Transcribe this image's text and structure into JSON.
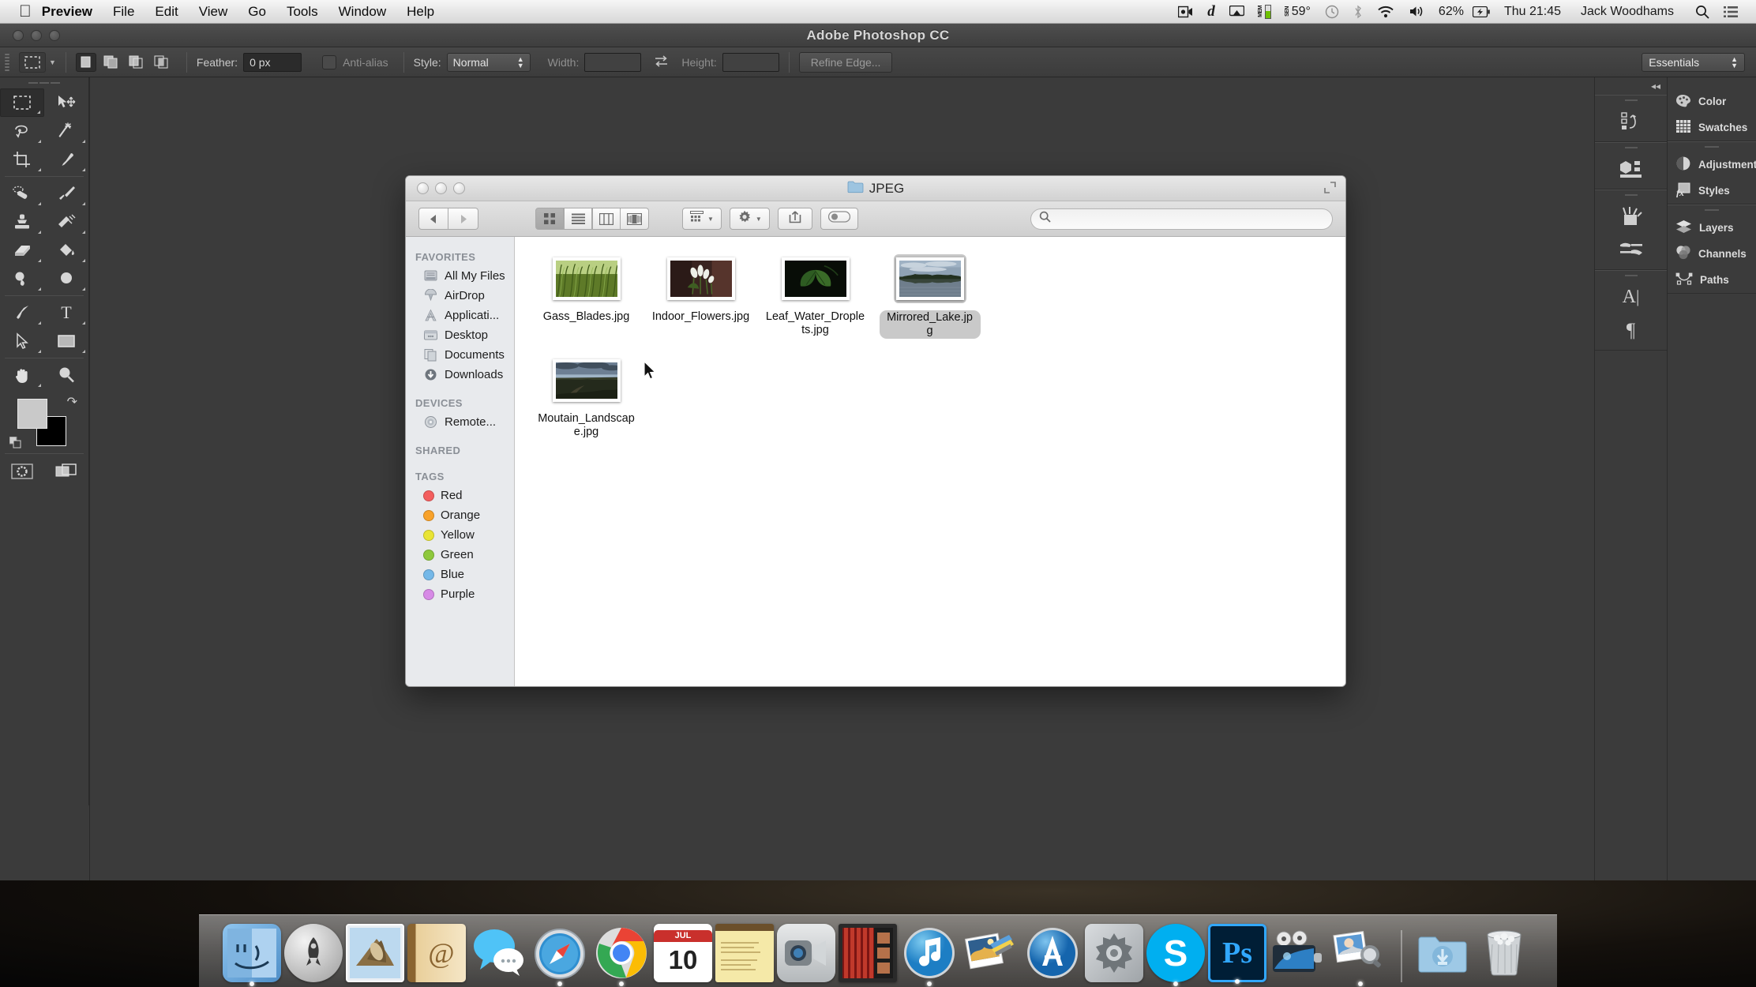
{
  "menubar": {
    "apple_icon": "apple-icon",
    "items": [
      {
        "label": "Preview",
        "bold": true
      },
      {
        "label": "File",
        "bold": false
      },
      {
        "label": "Edit",
        "bold": false
      },
      {
        "label": "View",
        "bold": false
      },
      {
        "label": "Go",
        "bold": false
      },
      {
        "label": "Tools",
        "bold": false
      },
      {
        "label": "Window",
        "bold": false
      },
      {
        "label": "Help",
        "bold": false
      }
    ],
    "status": {
      "screencast_icon": "screen-record-icon",
      "dropbox_icon": "dropbox-d-icon",
      "airplay_icon": "airplay-icon",
      "mem_label": "MEM",
      "sen_label": "SEN",
      "temperature": "59°",
      "timemachine_icon": "time-machine-icon",
      "bluetooth_icon": "bluetooth-icon",
      "wifi_icon": "wifi-icon",
      "volume_icon": "volume-icon",
      "battery_percent": "62%",
      "battery_icon": "battery-charging-icon",
      "clock": "Thu 21:45",
      "user": "Jack Woodhams",
      "spotlight_icon": "search-icon",
      "notification_icon": "notification-center-icon"
    }
  },
  "photoshop": {
    "title": "Adobe Photoshop CC",
    "options": {
      "tool_icon": "rectangular-marquee-icon",
      "selection_modes": [
        "new-selection",
        "add-to-selection",
        "subtract-from-selection",
        "intersect-selection"
      ],
      "feather_label": "Feather:",
      "feather_value": "0 px",
      "antialias_label": "Anti-alias",
      "antialias_checked": false,
      "style_label": "Style:",
      "style_value": "Normal",
      "width_label": "Width:",
      "width_value": "",
      "swap_icon": "swap-dimensions-icon",
      "height_label": "Height:",
      "height_value": "",
      "refine_edge_label": "Refine Edge...",
      "workspace_value": "Essentials"
    },
    "tools": [
      {
        "name": "rectangular-marquee-tool",
        "active": true
      },
      {
        "name": "move-tool",
        "active": false
      },
      {
        "name": "lasso-tool",
        "active": false
      },
      {
        "name": "magic-wand-tool",
        "active": false
      },
      {
        "name": "crop-tool",
        "active": false
      },
      {
        "name": "eyedropper-tool",
        "active": false
      },
      {
        "name": "spot-healing-brush-tool",
        "active": false
      },
      {
        "name": "brush-tool",
        "active": false
      },
      {
        "name": "clone-stamp-tool",
        "active": false
      },
      {
        "name": "history-brush-tool",
        "active": false
      },
      {
        "name": "eraser-tool",
        "active": false
      },
      {
        "name": "paint-bucket-tool",
        "active": false
      },
      {
        "name": "dodge-tool",
        "active": false
      },
      {
        "name": "blur-tool",
        "active": false
      },
      {
        "name": "pen-tool",
        "active": false
      },
      {
        "name": "type-tool",
        "active": false
      },
      {
        "name": "path-selection-tool",
        "active": false
      },
      {
        "name": "rectangle-shape-tool",
        "active": false
      },
      {
        "name": "hand-tool",
        "active": false
      },
      {
        "name": "zoom-tool",
        "active": false
      }
    ],
    "color_swatches": {
      "foreground": "#c9c9c9",
      "background": "#000000"
    },
    "bottom_tools": [
      {
        "name": "quick-mask-tool"
      },
      {
        "name": "screen-mode-tool"
      }
    ],
    "rail_icons": [
      {
        "name": "history-panel-icon"
      },
      {
        "name": "3d-panel-icon"
      },
      {
        "name": "brush-panel-icon"
      },
      {
        "name": "brush-presets-panel-icon"
      },
      {
        "name": "character-panel-icon"
      },
      {
        "name": "paragraph-panel-icon"
      }
    ],
    "panel_groups": [
      {
        "items": [
          {
            "label": "Color",
            "icon": "color-palette-icon"
          },
          {
            "label": "Swatches",
            "icon": "swatches-grid-icon"
          }
        ]
      },
      {
        "items": [
          {
            "label": "Adjustments",
            "icon": "adjustments-circle-icon"
          },
          {
            "label": "Styles",
            "icon": "styles-fx-icon"
          }
        ]
      },
      {
        "items": [
          {
            "label": "Layers",
            "icon": "layers-icon"
          },
          {
            "label": "Channels",
            "icon": "channels-icon"
          },
          {
            "label": "Paths",
            "icon": "paths-icon"
          }
        ]
      }
    ],
    "collapse_icon": "collapse-panels-icon"
  },
  "finder": {
    "title": "JPEG",
    "folder_icon": "folder-icon",
    "window_controls": [
      "close-button",
      "minimize-button",
      "zoom-button"
    ],
    "fullscreen_icon": "fullscreen-icon",
    "toolbar": {
      "back_icon": "back-arrow-icon",
      "forward_icon": "forward-arrow-icon",
      "view_modes": [
        {
          "name": "icon-view",
          "active": true
        },
        {
          "name": "list-view",
          "active": false
        },
        {
          "name": "column-view",
          "active": false
        },
        {
          "name": "coverflow-view",
          "active": false
        }
      ],
      "arrange_icon": "arrange-by-icon",
      "action_icon": "gear-icon",
      "share_icon": "share-icon",
      "tags_icon": "tags-icon"
    },
    "search": {
      "icon": "search-icon",
      "placeholder": "",
      "value": ""
    },
    "sidebar": [
      {
        "header": "FAVORITES",
        "items": [
          {
            "label": "All My Files",
            "icon": "all-my-files-icon"
          },
          {
            "label": "AirDrop",
            "icon": "airdrop-icon"
          },
          {
            "label": "Applicati...",
            "icon": "applications-icon"
          },
          {
            "label": "Desktop",
            "icon": "desktop-icon"
          },
          {
            "label": "Documents",
            "icon": "documents-icon"
          },
          {
            "label": "Downloads",
            "icon": "downloads-icon"
          }
        ]
      },
      {
        "header": "DEVICES",
        "items": [
          {
            "label": "Remote...",
            "icon": "remote-disc-icon"
          }
        ]
      },
      {
        "header": "SHARED",
        "items": []
      },
      {
        "header": "TAGS",
        "items": [
          {
            "label": "Red",
            "icon": "tag-dot",
            "color": "#f35e5e"
          },
          {
            "label": "Orange",
            "icon": "tag-dot",
            "color": "#f8a22a"
          },
          {
            "label": "Yellow",
            "icon": "tag-dot",
            "color": "#e9e435"
          },
          {
            "label": "Green",
            "icon": "tag-dot",
            "color": "#8ec83c"
          },
          {
            "label": "Blue",
            "icon": "tag-dot",
            "color": "#74b8e8"
          },
          {
            "label": "Purple",
            "icon": "tag-dot",
            "color": "#d78ae6"
          }
        ]
      }
    ],
    "files": [
      {
        "name": "Gass_Blades.jpg",
        "selected": false,
        "thumb": "grass"
      },
      {
        "name": "Indoor_Flowers.jpg",
        "selected": false,
        "thumb": "flowers"
      },
      {
        "name": "Leaf_Water_Droplets.jpg",
        "selected": false,
        "thumb": "leaf"
      },
      {
        "name": "Mirrored_Lake.jpg",
        "selected": true,
        "thumb": "lake"
      },
      {
        "name": "Moutain_Landscape.jpg",
        "selected": false,
        "thumb": "mountain"
      }
    ],
    "cursor": "arrow-cursor"
  },
  "dock": {
    "items": [
      {
        "label": "Finder",
        "icon": "finder-icon",
        "running": true
      },
      {
        "label": "Launchpad",
        "icon": "launchpad-icon",
        "running": false
      },
      {
        "label": "Mail",
        "icon": "mail-icon",
        "running": false
      },
      {
        "label": "Contacts",
        "icon": "contacts-icon",
        "running": false
      },
      {
        "label": "Messages",
        "icon": "messages-icon",
        "running": false
      },
      {
        "label": "Safari",
        "icon": "safari-icon",
        "running": true
      },
      {
        "label": "Google Chrome",
        "icon": "chrome-icon",
        "running": true
      },
      {
        "label": "Calendar",
        "icon": "calendar-icon",
        "running": false,
        "month": "JUL",
        "day": "10"
      },
      {
        "label": "Notes",
        "icon": "notes-icon",
        "running": false
      },
      {
        "label": "FaceTime",
        "icon": "facetime-icon",
        "running": false
      },
      {
        "label": "iMovie",
        "icon": "imovie-icon",
        "running": false
      },
      {
        "label": "iTunes",
        "icon": "itunes-icon",
        "running": true
      },
      {
        "label": "iPhoto",
        "icon": "iphoto-icon",
        "running": false
      },
      {
        "label": "App Store",
        "icon": "app-store-icon",
        "running": false
      },
      {
        "label": "System Preferences",
        "icon": "system-preferences-icon",
        "running": false
      },
      {
        "label": "Skype",
        "icon": "skype-icon",
        "running": true
      },
      {
        "label": "Adobe Photoshop CC",
        "icon": "photoshop-icon",
        "running": true
      },
      {
        "label": "QuickTime Player",
        "icon": "quicktime-icon",
        "running": false
      },
      {
        "label": "Preview",
        "icon": "preview-icon",
        "running": true
      }
    ],
    "downloads": {
      "label": "Downloads",
      "icon": "downloads-stack-icon"
    },
    "trash": {
      "label": "Trash",
      "icon": "trash-icon"
    }
  }
}
